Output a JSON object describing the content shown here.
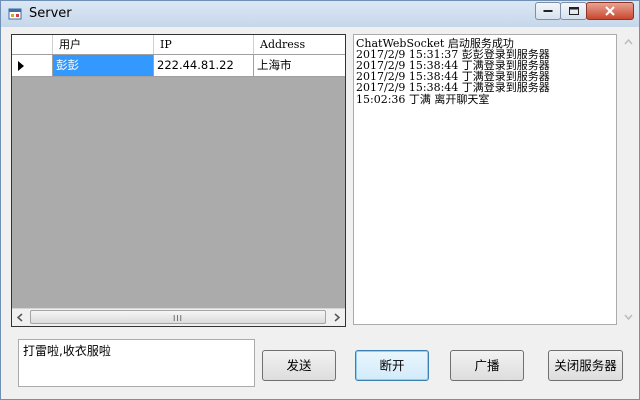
{
  "window": {
    "title": "Server"
  },
  "grid": {
    "columns": [
      "用户",
      "IP",
      "Address"
    ],
    "rows": [
      {
        "user": "彭彭",
        "ip": "222.44.81.22",
        "address": "上海市"
      }
    ],
    "scroll_grip": "III"
  },
  "log": {
    "lines": [
      "ChatWebSocket 启动服务成功",
      "2017/2/9 15:31:37 彭彭登录到服务器",
      "2017/2/9 15:38:44 丁满登录到服务器",
      "2017/2/9 15:38:44 丁满登录到服务器",
      "2017/2/9 15:38:44 丁满登录到服务器",
      "15:02:36 丁满 离开聊天室"
    ]
  },
  "input": {
    "value": "打雷啦,收衣服啦"
  },
  "buttons": {
    "send": "发送",
    "disconnect": "断开",
    "broadcast": "广播",
    "close_server": "关闭服务器"
  }
}
